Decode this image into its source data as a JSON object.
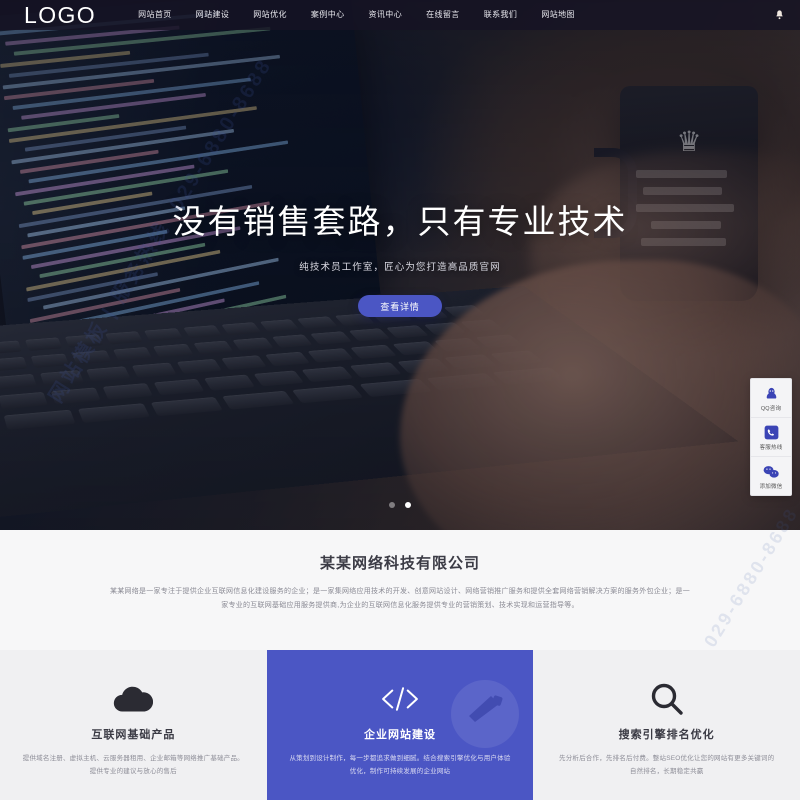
{
  "header": {
    "logo": "LOGO",
    "nav": [
      {
        "label": "网站首页"
      },
      {
        "label": "网站建设"
      },
      {
        "label": "网站优化"
      },
      {
        "label": "案例中心"
      },
      {
        "label": "资讯中心"
      },
      {
        "label": "在线留言"
      },
      {
        "label": "联系我们"
      },
      {
        "label": "网站地图"
      }
    ],
    "bell_icon": "bell-icon"
  },
  "hero": {
    "title": "没有销售套路，只有专业技术",
    "subtitle": "纯技术员工作室，匠心为您打造高品质官网",
    "button": "查看详情",
    "slides": [
      {
        "active": false
      },
      {
        "active": true
      }
    ]
  },
  "side_widget": {
    "items": [
      {
        "icon": "qq-penguin-icon",
        "label": "QQ咨询"
      },
      {
        "icon": "phone-icon",
        "label": "客服热线"
      },
      {
        "icon": "wechat-icon",
        "label": "添加微信"
      }
    ]
  },
  "about": {
    "title": "某某网络科技有限公司",
    "text": "某某网络是一家专注于提供企业互联网信息化建设服务的企业；是一家集网络应用技术的开发、创意网站设计、网络营销推广服务和提供全套网络营销解决方案的服务外包企业；是一家专业的互联网基础应用服务提供商,为企业的互联网信息化服务提供专业的营销策划、技术实现和运营指导等。"
  },
  "cards": [
    {
      "icon": "cloud-icon",
      "title": "互联网基础产品",
      "desc": "提供域名注册、虚拟主机、云服务器租用、企业邮箱等网络推广基础产品。提供专业的建议与放心的售后",
      "theme": "light"
    },
    {
      "icon": "code-brackets-icon",
      "title": "企业网站建设",
      "desc": "从策划到设计制作，每一步都追求做到细腻。结合搜索引擎优化与用户体验优化，制作可持续发展的企业网站",
      "theme": "accent"
    },
    {
      "icon": "search-magnifier-icon",
      "title": "搜索引擎排名优化",
      "desc": "先分析后合作，先排名后付费。整站SEO优化让您的网站有更多关键词的自然排名，长期稳定共赢",
      "theme": "light"
    }
  ],
  "watermark": {
    "line1": "网站模板 | 服务热线",
    "line2": "029-6880-8688"
  },
  "colors": {
    "accent": "#4b56c4",
    "nav_bg": "#161424",
    "about_bg": "#f7f7f8",
    "card_light_bg": "#f0f0f2"
  }
}
